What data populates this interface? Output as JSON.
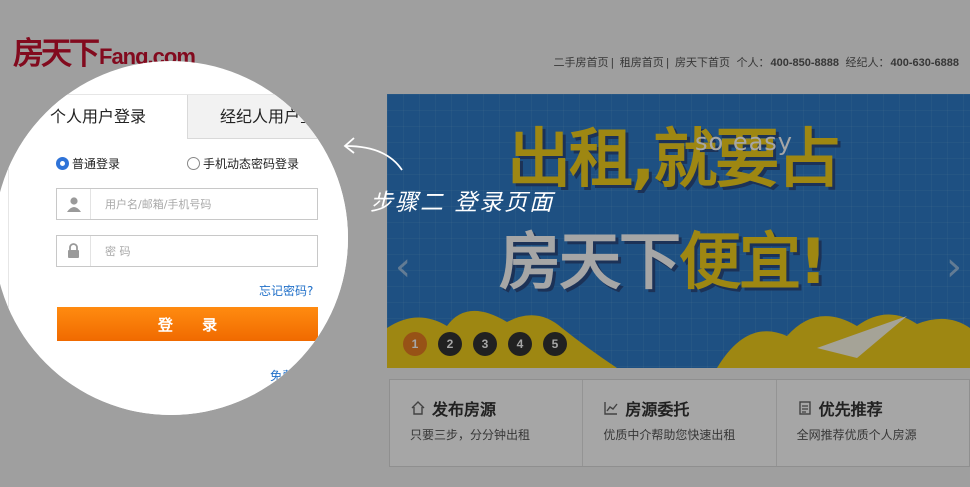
{
  "header": {
    "logo_cn": "房天下",
    "logo_en": "Fang.com",
    "nav": [
      "二手房首页",
      "租房首页",
      "房天下首页"
    ],
    "hotline_personal_label": "个人：",
    "hotline_personal": "400-850-8888",
    "hotline_agent_label": "经纪人：",
    "hotline_agent": "400-630-6888",
    "separator": "|"
  },
  "login": {
    "tabs": [
      {
        "label": "个人用户登录",
        "active": true
      },
      {
        "label": "经纪人用户登录",
        "active": false
      }
    ],
    "radio_normal": "普通登录",
    "radio_mobile": "手机动态密码登录",
    "username_placeholder": "用户名/邮箱/手机号码",
    "password_placeholder": "密 码",
    "forgot": "忘记密码?",
    "submit": "登 录",
    "register": "免费注册"
  },
  "banner": {
    "line1": "出租,就要占",
    "soeasy": "so easy",
    "line2_a": "房天下",
    "line2_b": "便宜!",
    "slides": [
      "1",
      "2",
      "3",
      "4",
      "5"
    ],
    "active_slide": 1,
    "prev": "‹",
    "next": "›"
  },
  "services": [
    {
      "title": "发布房源",
      "sub": "只要三步，分分钟出租",
      "icon": "house-icon"
    },
    {
      "title": "房源委托",
      "sub": "优质中介帮助您快速出租",
      "icon": "chart-icon"
    },
    {
      "title": "优先推荐",
      "sub": "全网推荐优质个人房源",
      "icon": "document-icon"
    }
  ],
  "annotation": "步骤二  登录页面",
  "colors": {
    "brand_red": "#c8102e",
    "login_orange": "#f57a00",
    "link_blue": "#1f6fc8",
    "banner_blue": "#2e7cc8",
    "banner_yellow": "#f3cf1d",
    "active_dot": "#e87f22"
  }
}
